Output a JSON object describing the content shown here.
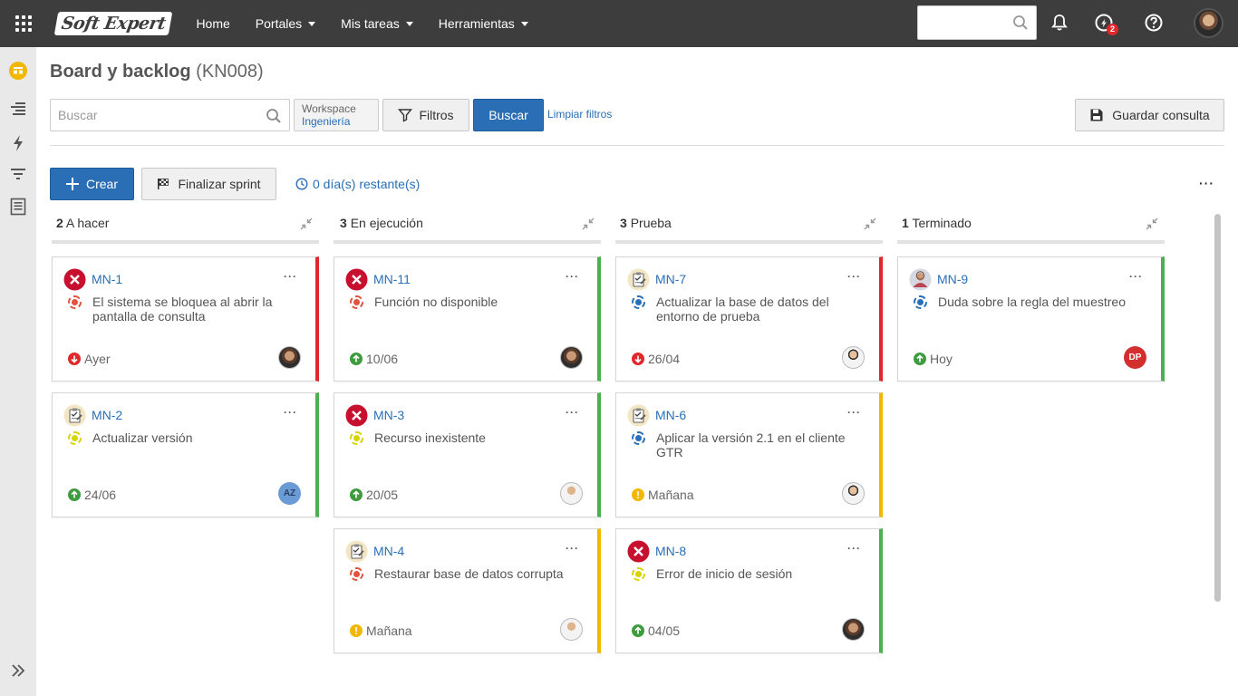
{
  "topbar": {
    "logo": "Soft Expert",
    "nav": [
      {
        "label": "Home",
        "dropdown": false
      },
      {
        "label": "Portales",
        "dropdown": true
      },
      {
        "label": "Mis tareas",
        "dropdown": true
      },
      {
        "label": "Herramientas",
        "dropdown": true
      }
    ],
    "search_placeholder": "",
    "notifications_badge": "2"
  },
  "page": {
    "title": "Board y backlog",
    "code": "(KN008)"
  },
  "filters": {
    "search_placeholder": "Buscar",
    "workspace_label": "Workspace",
    "workspace_value": "Ingeniería",
    "filters_label": "Filtros",
    "search_button": "Buscar",
    "clear_link": "Limpiar filtros",
    "save_query": "Guardar consulta"
  },
  "toolbar": {
    "create_label": "Crear",
    "finish_sprint_label": "Finalizar sprint",
    "remaining_label": "0 día(s) restante(s)"
  },
  "colors": {
    "red": "#e0282c",
    "green": "#4caf50",
    "yellow": "#f2b800",
    "primary": "#2a6fb5"
  },
  "columns": [
    {
      "count": "2",
      "name": "A hacer",
      "cards": [
        {
          "id": "MN-1",
          "title": "El sistema se bloquea al abrir la pantalla de consulta",
          "type": "error",
          "status": "red",
          "priority": "down",
          "date": "Ayer",
          "assignee": "photo-man",
          "edge": "red"
        },
        {
          "id": "MN-2",
          "title": "Actualizar versión",
          "type": "task",
          "status": "yellow",
          "priority": "up",
          "date": "24/06",
          "assignee": "AZ",
          "edge": "green"
        }
      ]
    },
    {
      "count": "3",
      "name": "En ejecución",
      "cards": [
        {
          "id": "MN-11",
          "title": "Función no disponible",
          "type": "error",
          "status": "red",
          "priority": "up",
          "date": "10/06",
          "assignee": "photo-man",
          "edge": "green"
        },
        {
          "id": "MN-3",
          "title": "Recurso inexistente",
          "type": "error",
          "status": "yellow",
          "priority": "up",
          "date": "20/05",
          "assignee": "avatar-man",
          "edge": "green"
        },
        {
          "id": "MN-4",
          "title": "Restaurar base de datos corrupta",
          "type": "task",
          "status": "red",
          "priority": "warn",
          "date": "Mañana",
          "assignee": "avatar-man",
          "edge": "yellow"
        }
      ]
    },
    {
      "count": "3",
      "name": "Prueba",
      "cards": [
        {
          "id": "MN-7",
          "title": "Actualizar la base de datos del entorno de prueba",
          "type": "task",
          "status": "blue",
          "priority": "down",
          "date": "26/04",
          "assignee": "avatar-dark",
          "edge": "red"
        },
        {
          "id": "MN-6",
          "title": "Aplicar la versión 2.1 en el cliente GTR",
          "type": "task",
          "status": "blue",
          "priority": "warn",
          "date": "Mañana",
          "assignee": "avatar-dark",
          "edge": "yellow"
        },
        {
          "id": "MN-8",
          "title": "Error de inicio de sesión",
          "type": "error",
          "status": "yellow",
          "priority": "up",
          "date": "04/05",
          "assignee": "photo-man",
          "edge": "green"
        }
      ]
    },
    {
      "count": "1",
      "name": "Terminado",
      "cards": [
        {
          "id": "MN-9",
          "title": "Duda sobre la regla del muestreo",
          "type": "question",
          "status": "blue",
          "priority": "up",
          "date": "Hoy",
          "assignee": "DP",
          "edge": "green"
        }
      ]
    }
  ]
}
